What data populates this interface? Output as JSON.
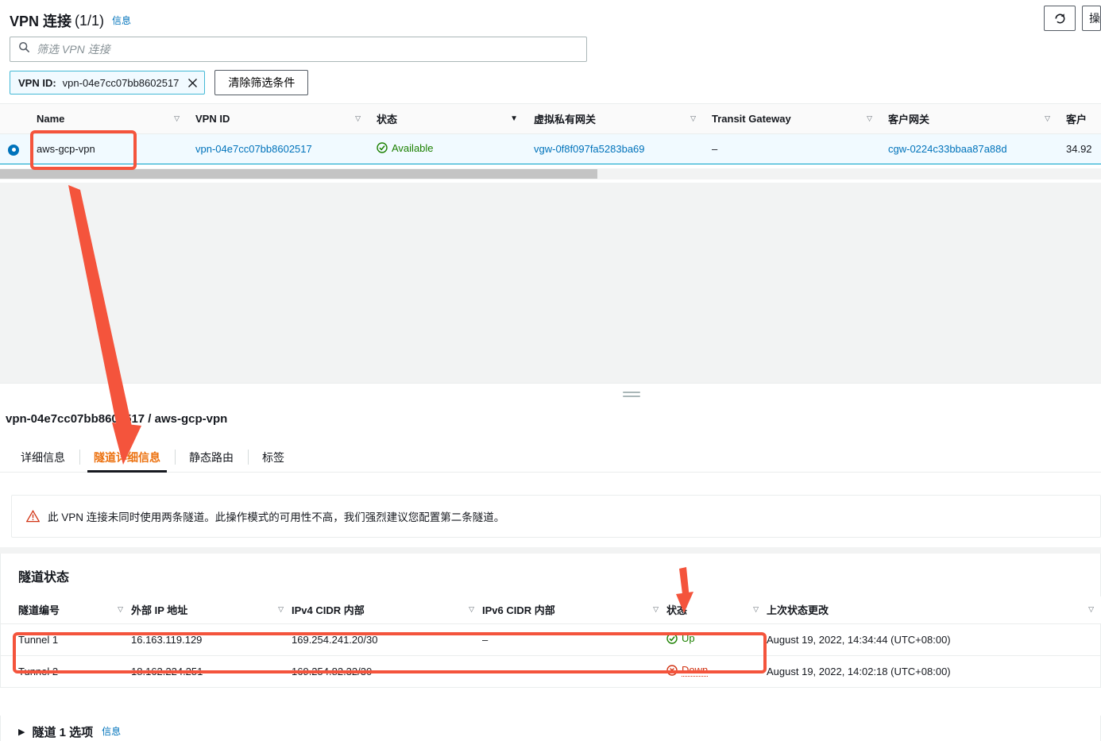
{
  "header": {
    "title": "VPN 连接",
    "count": "(1/1)",
    "info_label": "信息",
    "refresh_icon": "refresh-icon",
    "actions_label": "操"
  },
  "search": {
    "placeholder": "筛选 VPN 连接",
    "value": "",
    "icon": "search-icon"
  },
  "filters": {
    "token_key": "VPN ID:",
    "token_value": "vpn-04e7cc07bb8602517",
    "clear_label": "清除筛选条件"
  },
  "vpn_table": {
    "columns": [
      "Name",
      "VPN ID",
      "状态",
      "虚拟私有网关",
      "Transit Gateway",
      "客户网关",
      "客户"
    ],
    "rows": [
      {
        "name": "aws-gcp-vpn",
        "vpn_id": "vpn-04e7cc07bb8602517",
        "state": "Available",
        "vgw": "vgw-0f8f097fa5283ba69",
        "tgw": "–",
        "cgw": "cgw-0224c33bbaa87a88d",
        "cgw_addr": "34.92"
      }
    ]
  },
  "detail": {
    "title": "vpn-04e7cc07bb8602517 / aws-gcp-vpn",
    "tabs": [
      {
        "label": "详细信息",
        "active": false
      },
      {
        "label": "隧道详细信息",
        "active": true
      },
      {
        "label": "静态路由",
        "active": false
      },
      {
        "label": "标签",
        "active": false
      }
    ],
    "alert": {
      "icon": "warning-icon",
      "text": "此 VPN 连接未同时使用两条隧道。此操作模式的可用性不高，我们强烈建议您配置第二条隧道。"
    },
    "tunnel_section_title": "隧道状态",
    "tunnel_columns": [
      "隧道编号",
      "外部 IP 地址",
      "IPv4 CIDR 内部",
      "IPv6 CIDR 内部",
      "状态",
      "上次状态更改"
    ],
    "tunnel_rows": [
      {
        "number": "Tunnel 1",
        "outside_ip": "16.163.119.129",
        "ipv4_cidr": "169.254.241.20/30",
        "ipv6_cidr": "–",
        "status": "Up",
        "status_kind": "up",
        "last_change": "August 19, 2022, 14:34:44 (UTC+08:00)"
      },
      {
        "number": "Tunnel 2",
        "outside_ip": "18.162.224.251",
        "ipv4_cidr": "169.254.82.32/30",
        "ipv6_cidr": "–",
        "status": "Down",
        "status_kind": "down",
        "last_change": "August 19, 2022, 14:02:18 (UTC+08:00)"
      }
    ],
    "expand": {
      "label": "隧道 1 选项",
      "info_label": "信息",
      "caret": "caret-right-icon"
    }
  },
  "colors": {
    "accent_orange": "#ec7211",
    "link_blue": "#0073bb",
    "selected_blue": "#00a1c9",
    "success_green": "#1d8102",
    "error_red": "#d13212",
    "annotation_red": "#f4543c"
  }
}
